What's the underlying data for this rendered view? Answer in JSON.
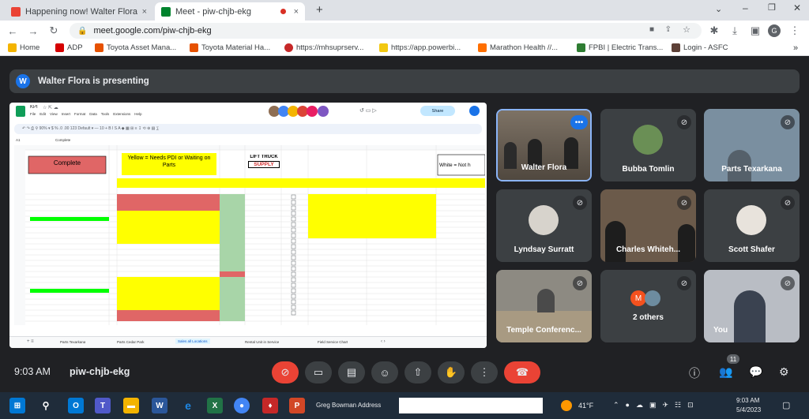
{
  "browser": {
    "tabs": [
      {
        "title": "Happening now! Walter Flora is",
        "close": "×"
      },
      {
        "title": "Meet - piw-chjb-ekg",
        "close": "×"
      }
    ],
    "new_tab": "+",
    "url": "meet.google.com/piw-chjb-ekg",
    "bookmarks": [
      "Home",
      "ADP",
      "Toyota Asset Mana...",
      "Toyota Material Ha...",
      "https://mhsuprserv...",
      "https://app.powerbi...",
      "Marathon Health //...",
      "FPBI | Electric Trans...",
      "Login - ASFC"
    ]
  },
  "meet": {
    "presenter_initial": "W",
    "presenting_text": "Walter Flora is presenting",
    "participants": [
      {
        "name": "Walter Flora"
      },
      {
        "name": "Bubba Tomlin"
      },
      {
        "name": "Parts Texarkana"
      },
      {
        "name": "Lyndsay Surratt"
      },
      {
        "name": "Charles Whiteh..."
      },
      {
        "name": "Scott Shafer"
      },
      {
        "name": "Temple Conferenc..."
      },
      {
        "name": "2 others"
      },
      {
        "name": "You"
      }
    ],
    "others_initial": "M",
    "time": "9:03 AM",
    "meeting_code": "piw-chjb-ekg",
    "people_count": "11"
  },
  "sheet": {
    "doc_title": "KPI",
    "menu": [
      "File",
      "Edit",
      "View",
      "Insert",
      "Format",
      "Data",
      "Tools",
      "Extensions",
      "Help"
    ],
    "share_label": "Share",
    "cell_ref": "A1",
    "formula": "Complete",
    "complete": "Complete",
    "yellow_note": "Yellow = Needs PDI or Waiting on Parts",
    "logo_top": "LIFT TRUCK",
    "logo_bottom": "SUPPLY",
    "white_note": "White = Not h",
    "sheet_tabs": [
      "Parts Texarkana",
      "Parts Cedar Park",
      "Sales all Locations",
      "Rental Unit in Service",
      "Field Service Chart"
    ]
  },
  "taskbar": {
    "search_label": "Greg Bowman  Address",
    "weather": "41°F",
    "clock_time": "9:03 AM",
    "clock_date": "5/4/2023"
  },
  "colors": {
    "accent": "#1a73e8",
    "end_call": "#ea4335",
    "complete_red": "#e06666",
    "yellow": "#ffff00",
    "green": "#00ff00"
  }
}
